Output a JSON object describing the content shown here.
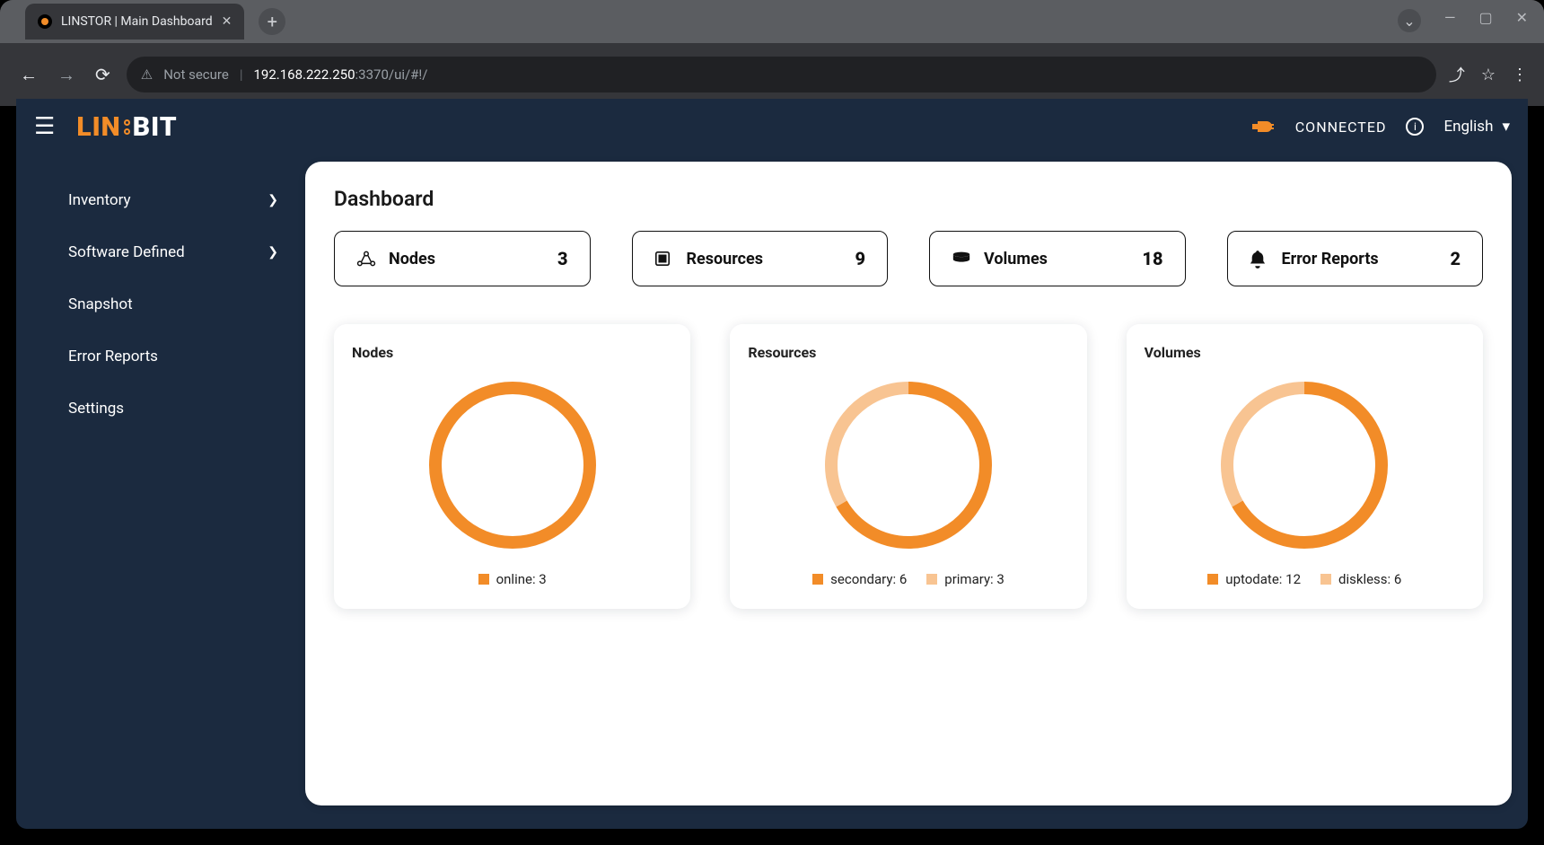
{
  "browser": {
    "tab_title": "LINSTOR | Main Dashboard",
    "secure_label": "Not secure",
    "url_host": "192.168.222.250",
    "url_path": ":3370/ui/#!/"
  },
  "header": {
    "connection_status": "CONNECTED",
    "language": "English"
  },
  "sidebar": {
    "items": [
      {
        "label": "Inventory",
        "expandable": true
      },
      {
        "label": "Software Defined",
        "expandable": true
      },
      {
        "label": "Snapshot",
        "expandable": false
      },
      {
        "label": "Error Reports",
        "expandable": false
      },
      {
        "label": "Settings",
        "expandable": false
      }
    ]
  },
  "page": {
    "title": "Dashboard"
  },
  "stats": [
    {
      "icon": "nodes",
      "label": "Nodes",
      "count": "3"
    },
    {
      "icon": "resources",
      "label": "Resources",
      "count": "9"
    },
    {
      "icon": "volumes",
      "label": "Volumes",
      "count": "18"
    },
    {
      "icon": "bell",
      "label": "Error Reports",
      "count": "2"
    }
  ],
  "colors": {
    "primary": "#f28c28",
    "primary_light": "#f8c492"
  },
  "chart_data": [
    {
      "type": "pie",
      "title": "Nodes",
      "series": [
        {
          "name": "online",
          "value": 3,
          "color": "#f28c28"
        }
      ],
      "legend": [
        "online: 3"
      ]
    },
    {
      "type": "pie",
      "title": "Resources",
      "series": [
        {
          "name": "secondary",
          "value": 6,
          "color": "#f28c28"
        },
        {
          "name": "primary",
          "value": 3,
          "color": "#f8c492"
        }
      ],
      "legend": [
        "secondary: 6",
        "primary: 3"
      ]
    },
    {
      "type": "pie",
      "title": "Volumes",
      "series": [
        {
          "name": "uptodate",
          "value": 12,
          "color": "#f28c28"
        },
        {
          "name": "diskless",
          "value": 6,
          "color": "#f8c492"
        }
      ],
      "legend": [
        "uptodate: 12",
        "diskless: 6"
      ]
    }
  ]
}
